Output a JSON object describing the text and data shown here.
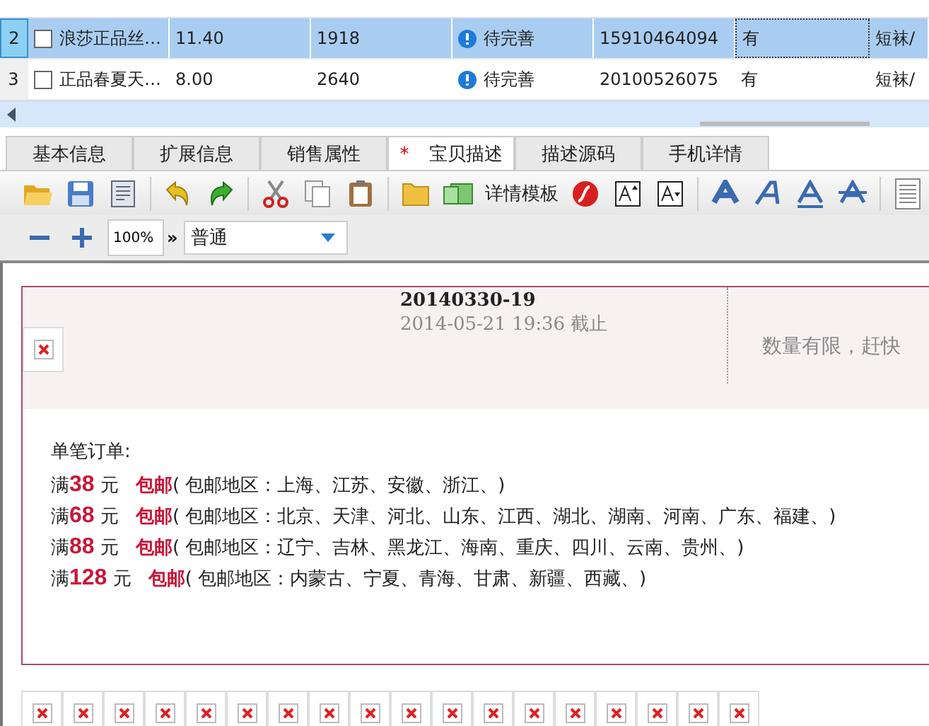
{
  "table": {
    "rows": [
      {
        "number": "2",
        "selected": true,
        "checked": false,
        "title": "浪莎正品丝…",
        "price": "11.40",
        "stock": "1918",
        "status": "待完善",
        "code": "15910464094",
        "has": "有",
        "category": "短袜/"
      },
      {
        "number": "3",
        "selected": false,
        "checked": false,
        "title": "正品春夏天…",
        "price": "8.00",
        "stock": "2640",
        "status": "待完善",
        "code": "20100526075",
        "has": "有",
        "category": "短袜/"
      }
    ]
  },
  "tabs": [
    {
      "label": "基本信息",
      "selected": false,
      "modified": false
    },
    {
      "label": "扩展信息",
      "selected": false,
      "modified": false
    },
    {
      "label": "销售属性",
      "selected": false,
      "modified": false
    },
    {
      "label": "宝贝描述",
      "selected": true,
      "modified": true,
      "marker": "*"
    },
    {
      "label": "描述源码",
      "selected": false,
      "modified": false
    },
    {
      "label": "手机详情",
      "selected": false,
      "modified": false
    }
  ],
  "toolbar": {
    "template_label": "详情模板"
  },
  "zoom": {
    "value": "100%",
    "more": "»",
    "style": "普通"
  },
  "content": {
    "heading": "20140330-19",
    "deadline": "2014-05-21 19:36 截止",
    "notice": "数量有限，赶快",
    "order_label": "单笔订单:",
    "rules": [
      {
        "prefix": "满",
        "amount": "38",
        "unit": "元",
        "label": "包邮",
        "regions": "( 包邮地区：上海、江苏、安徽、浙江、)"
      },
      {
        "prefix": "满",
        "amount": "68",
        "unit": "元",
        "label": "包邮",
        "regions": "( 包邮地区：北京、天津、河北、山东、江西、湖北、湖南、河南、广东、福建、)"
      },
      {
        "prefix": "满",
        "amount": "88",
        "unit": "元",
        "label": "包邮",
        "regions": "( 包邮地区：辽宁、吉林、黑龙江、海南、重庆、四川、云南、贵州、)"
      },
      {
        "prefix": "满",
        "amount": "128",
        "unit": "元",
        "label": "包邮",
        "regions": "( 包邮地区：内蒙古、宁夏、青海、甘肃、新疆、西藏、)"
      }
    ],
    "thumbnails": [
      {
        "kind": "broken"
      },
      {
        "kind": "broken"
      },
      {
        "kind": "broken"
      },
      {
        "kind": "broken"
      },
      {
        "kind": "broken"
      },
      {
        "kind": "broken"
      },
      {
        "kind": "broken"
      },
      {
        "kind": "broken"
      },
      {
        "kind": "broken"
      },
      {
        "kind": "broken"
      },
      {
        "kind": "broken"
      },
      {
        "kind": "broken"
      },
      {
        "kind": "broken"
      },
      {
        "kind": "broken"
      },
      {
        "kind": "broken"
      },
      {
        "kind": "broken"
      },
      {
        "kind": "broken"
      },
      {
        "kind": "broken"
      }
    ]
  }
}
